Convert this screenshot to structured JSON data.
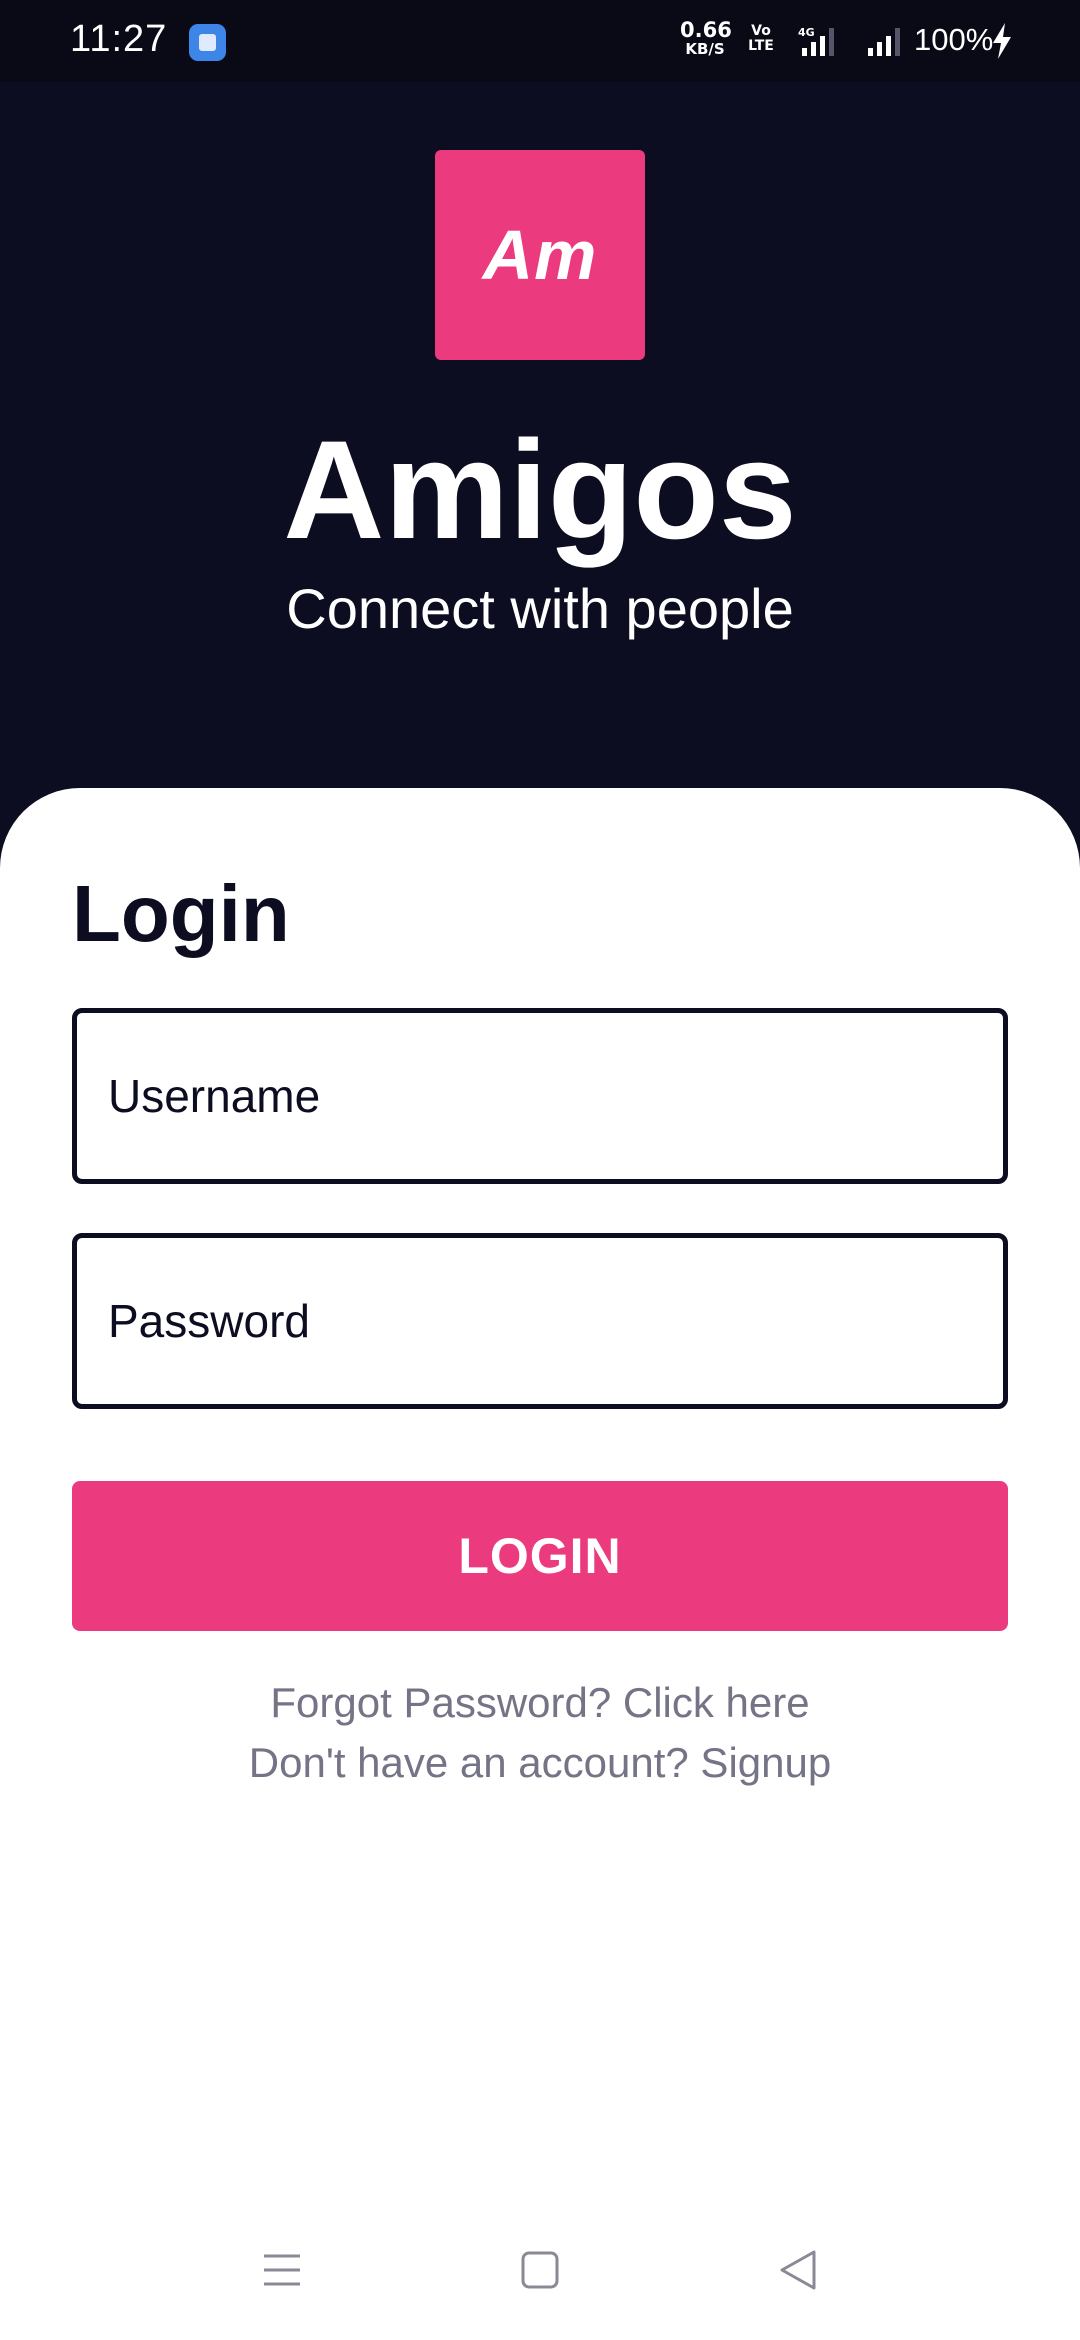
{
  "status_bar": {
    "time": "11:27",
    "speed_value": "0.66",
    "speed_unit": "KB/S",
    "volte_top": "Vo",
    "volte_bottom": "LTE",
    "network_type": "4G",
    "battery": "100%",
    "icons": [
      "app-notification-icon",
      "volte-icon",
      "signal-icon",
      "signal-icon",
      "charging-icon"
    ]
  },
  "header": {
    "logo_text": "Am",
    "app_name": "Amigos",
    "tagline": "Connect with people"
  },
  "login": {
    "title": "Login",
    "username_placeholder": "Username",
    "password_placeholder": "Password",
    "button_label": "LOGIN",
    "forgot_text": "Forgot Password? Click here",
    "signup_text": "Don't have an account? Signup"
  },
  "nav_bar": {
    "icons": [
      "menu-icon",
      "home-icon",
      "back-icon"
    ]
  },
  "colors": {
    "background": "#0d0d21",
    "accent": "#ec3a7e",
    "card": "#ffffff",
    "link": "#747486"
  }
}
